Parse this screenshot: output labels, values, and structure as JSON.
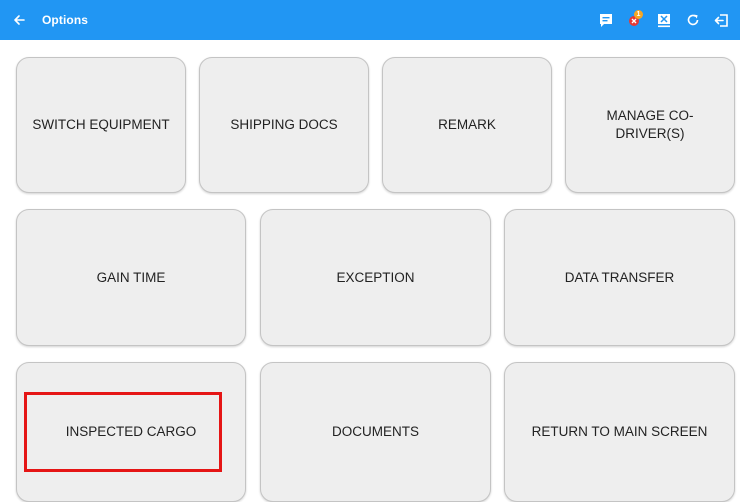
{
  "header": {
    "title": "Options",
    "bg_color": "#2196f3",
    "icons": [
      "back-arrow-icon",
      "message-icon",
      "alert-error-icon",
      "sync-error-icon",
      "refresh-icon",
      "logout-icon"
    ],
    "notification_badge": "1"
  },
  "tiles": {
    "switch_equipment": "SWITCH EQUIPMENT",
    "shipping_docs": "SHIPPING DOCS",
    "remark": "REMARK",
    "manage_codrivers": "MANAGE CO-DRIVER(S)",
    "gain_time": "GAIN TIME",
    "exception": "EXCEPTION",
    "data_transfer": "DATA TRANSFER",
    "inspected_cargo": "INSPECTED CARGO",
    "documents": "DOCUMENTS",
    "return_main": "RETURN TO MAIN SCREEN"
  },
  "highlight_color": "#e51515"
}
